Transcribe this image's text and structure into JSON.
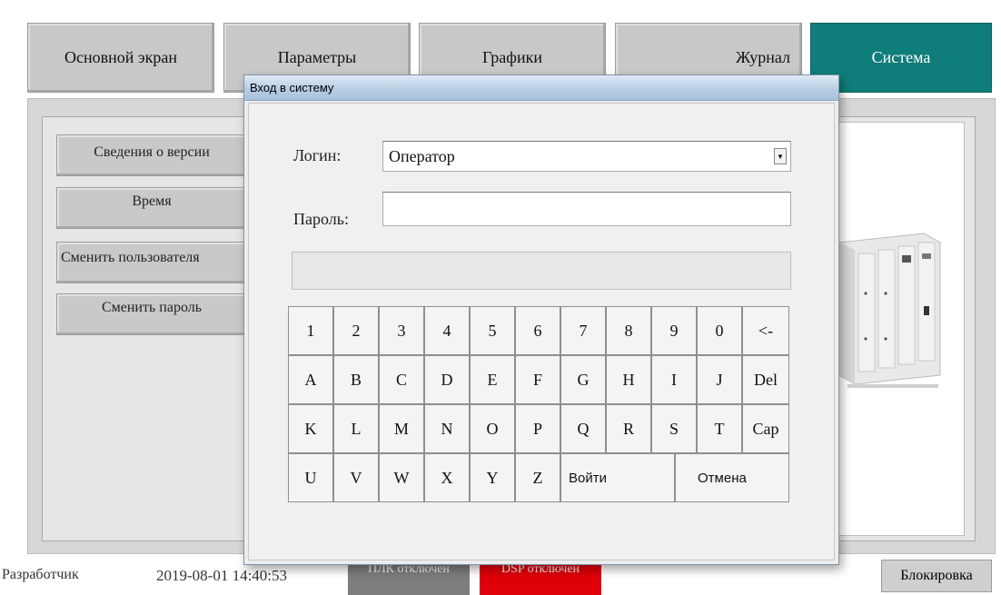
{
  "tabs": [
    {
      "label": "Основной экран",
      "active": false
    },
    {
      "label": "Параметры",
      "active": false
    },
    {
      "label": "Графики",
      "active": false
    },
    {
      "label": "Журнал",
      "active": false
    },
    {
      "label": "Система",
      "active": true
    }
  ],
  "sidebar": {
    "items": [
      {
        "label": "Сведения о версии"
      },
      {
        "label": "Время"
      },
      {
        "label": "Сменить пользователя"
      },
      {
        "label": "Сменить пароль"
      }
    ]
  },
  "status": {
    "role": "Разработчик",
    "datetime": "2019-08-01 14:40:53",
    "plc": "ПЛК отключен",
    "dsp": "DSP отключен",
    "lock_label": "Блокировка"
  },
  "dialog": {
    "title": "Вход в систему",
    "login_label": "Логин:",
    "login_value": "Оператор",
    "password_label": "Пароль:",
    "password_value": "",
    "message": "",
    "keys": {
      "row1": [
        "1",
        "2",
        "3",
        "4",
        "5",
        "6",
        "7",
        "8",
        "9",
        "0",
        "<-"
      ],
      "row2": [
        "A",
        "B",
        "C",
        "D",
        "E",
        "F",
        "G",
        "H",
        "I",
        "J",
        "Del"
      ],
      "row3": [
        "K",
        "L",
        "M",
        "N",
        "O",
        "P",
        "Q",
        "R",
        "S",
        "T",
        "Cap"
      ],
      "row4": [
        "U",
        "V",
        "W",
        "X",
        "Y",
        "Z"
      ]
    },
    "login_button": "Войти",
    "cancel_button": "Отмена"
  },
  "colors": {
    "active_tab": "#0f7d7a",
    "plc_badge": "#7d7d7d",
    "dsp_badge": "#e0000a",
    "dialog_title": "#b6cde4"
  }
}
